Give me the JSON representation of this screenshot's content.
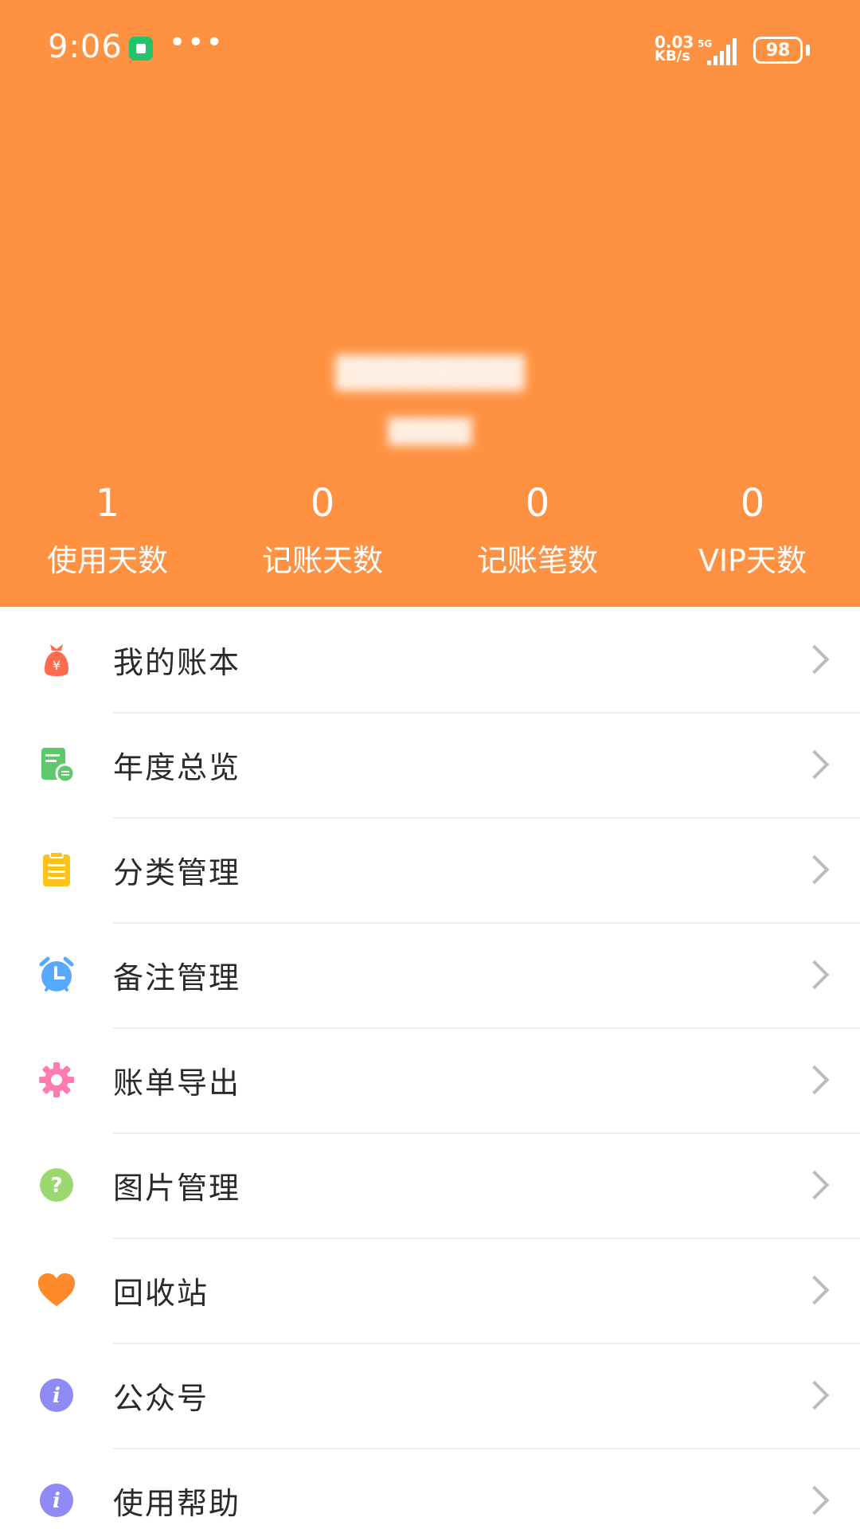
{
  "status_bar": {
    "time": "9:06",
    "net_speed": "0.03",
    "net_unit": "KB/s",
    "net_type": "5G",
    "battery": "98"
  },
  "stats": [
    {
      "value": "1",
      "label": "使用天数"
    },
    {
      "value": "0",
      "label": "记账天数"
    },
    {
      "value": "0",
      "label": "记账笔数"
    },
    {
      "value": "0",
      "label": "VIP天数"
    }
  ],
  "menu": [
    {
      "label": "我的账本",
      "icon": "money-bag-icon",
      "color": "#FF6B4E"
    },
    {
      "label": "年度总览",
      "icon": "document-list-icon",
      "color": "#5CC96B"
    },
    {
      "label": "分类管理",
      "icon": "clipboard-icon",
      "color": "#FFC21A"
    },
    {
      "label": "备注管理",
      "icon": "alarm-clock-icon",
      "color": "#57A8FF"
    },
    {
      "label": "账单导出",
      "icon": "gear-icon",
      "color": "#FF7BB0"
    },
    {
      "label": "图片管理",
      "icon": "question-icon",
      "color": "#9BD970"
    },
    {
      "label": "回收站",
      "icon": "heart-icon",
      "color": "#FF8A2B"
    },
    {
      "label": "公众号",
      "icon": "info-icon",
      "color": "#8F8AF5"
    },
    {
      "label": "使用帮助",
      "icon": "info-icon",
      "color": "#8F8AF5"
    }
  ],
  "colors": {
    "header": "#FF9242",
    "chevron": "#BDBDBD"
  }
}
